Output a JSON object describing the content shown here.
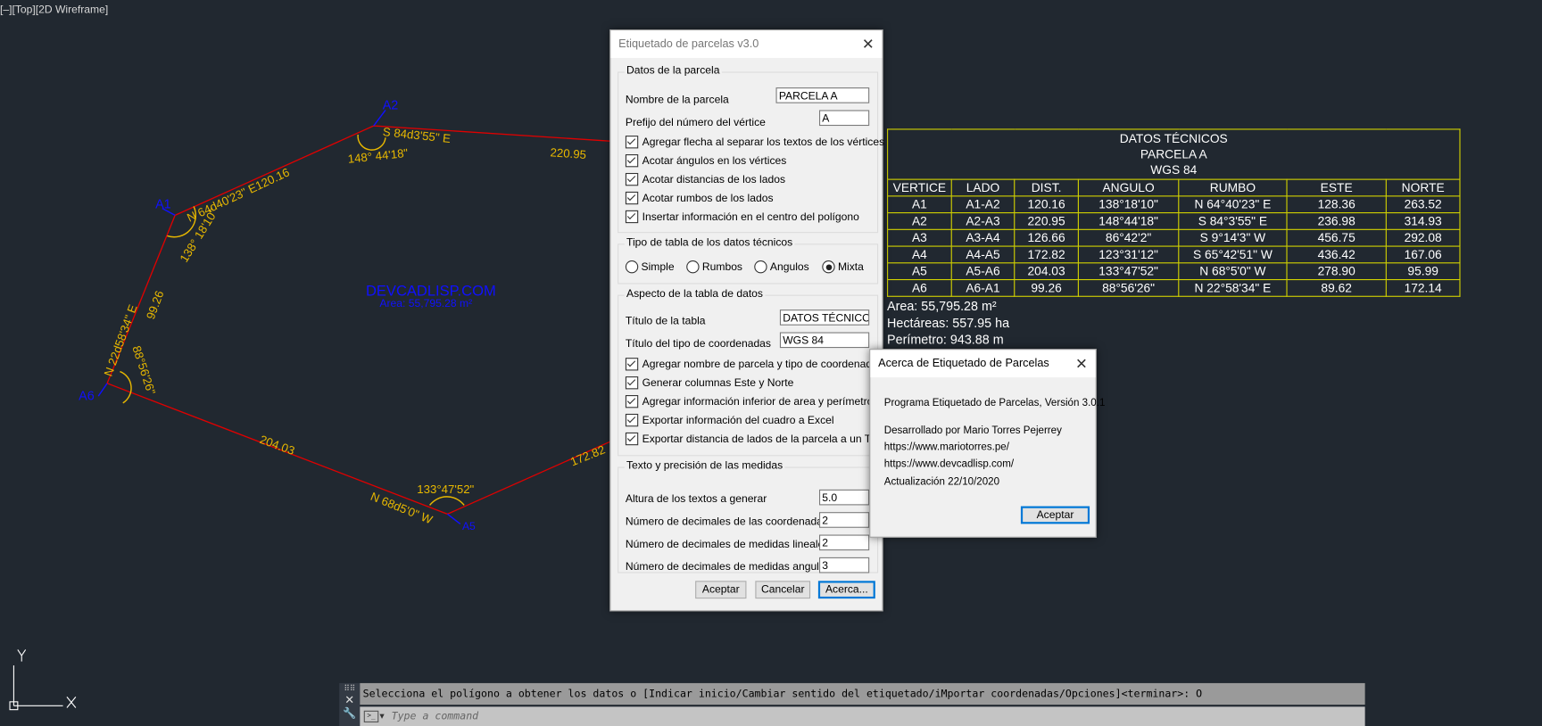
{
  "viewport": {
    "label": "[–][Top][2D Wireframe]"
  },
  "colors": {
    "background": "#212830",
    "polyline": "#e00000",
    "dim_text": "#e8b800",
    "vertex": "#1010ff",
    "table_border": "#d4d400",
    "accent": "#0078d7"
  },
  "drawing": {
    "vertices": [
      "A1",
      "A2",
      "A5",
      "A6"
    ],
    "labels": [
      "220.95",
      "148° 44'18\"",
      "S 84d3'55\" E",
      "N 64d40'23\" E120.16",
      "138° 18'10\"",
      "99.26",
      "N 22d58'34\" E",
      "88°56'26\"",
      "204.03",
      "N 68d5'0\" W",
      "133°47'52\"",
      "172.82"
    ],
    "center_title": "DEVCADLISP.COM",
    "center_area": "Area: 55,795.28 m²"
  },
  "dialog": {
    "title": "Etiquetado de parcelas v3.0",
    "group1": {
      "title": "Datos de la parcela",
      "name_label": "Nombre de la parcela",
      "name_value": "PARCELA A",
      "prefix_label": "Prefijo del número del vértice",
      "prefix_value": "A",
      "checks": [
        "Agregar flecha al separar los textos de los vértices",
        "Acotar ángulos en los vértices",
        "Acotar distancias de los lados",
        "Acotar rumbos de los lados",
        "Insertar información en el centro del polígono"
      ]
    },
    "group2": {
      "title": "Tipo de tabla de los datos técnicos",
      "options": [
        "Simple",
        "Rumbos",
        "Angulos",
        "Mixta"
      ],
      "selected": "Mixta"
    },
    "group3": {
      "title": "Aspecto de la tabla de datos",
      "table_title_label": "Título de la tabla",
      "table_title_value": "DATOS TÉCNICOS",
      "coord_label": "Título del tipo de coordenadas",
      "coord_value": "WGS 84",
      "checks": [
        "Agregar nombre de parcela y tipo de coordenadas",
        "Generar columnas Este y Norte",
        "Agregar información inferior de area y perímetro",
        "Exportar información del cuadro a Excel",
        "Exportar distancia de lados de la parcela a un TXT"
      ]
    },
    "group4": {
      "title": "Texto y precisión de las medidas",
      "rows": [
        {
          "label": "Altura de los textos a generar",
          "value": "5.0"
        },
        {
          "label": "Número de decimales de las coordenadas",
          "value": "2"
        },
        {
          "label": "Número de decimales de medidas lineales",
          "value": "2"
        },
        {
          "label": "Número de decimales de medidas angulares",
          "value": "3"
        }
      ]
    },
    "buttons": {
      "ok": "Aceptar",
      "cancel": "Cancelar",
      "about": "Acerca..."
    }
  },
  "table": {
    "titles": [
      "DATOS TÉCNICOS",
      "PARCELA A",
      "WGS 84"
    ],
    "headers": [
      "VERTICE",
      "LADO",
      "DIST.",
      "ANGULO",
      "RUMBO",
      "ESTE",
      "NORTE"
    ],
    "rows": [
      [
        "A1",
        "A1-A2",
        "120.16",
        "138°18'10\"",
        "N 64°40'23\" E",
        "128.36",
        "263.52"
      ],
      [
        "A2",
        "A2-A3",
        "220.95",
        "148°44'18\"",
        "S 84°3'55\" E",
        "236.98",
        "314.93"
      ],
      [
        "A3",
        "A3-A4",
        "126.66",
        "86°42'2\"",
        "S 9°14'3\" W",
        "456.75",
        "292.08"
      ],
      [
        "A4",
        "A4-A5",
        "172.82",
        "123°31'12\"",
        "S 65°42'51\" W",
        "436.42",
        "167.06"
      ],
      [
        "A5",
        "A5-A6",
        "204.03",
        "133°47'52\"",
        "N 68°5'0\" W",
        "278.90",
        "95.99"
      ],
      [
        "A6",
        "A6-A1",
        "99.26",
        "88°56'26\"",
        "N 22°58'34\" E",
        "89.62",
        "172.14"
      ]
    ],
    "area": "Area: 55,795.28 m²",
    "hectares": "Hectáreas: 557.95 ha",
    "perimeter": "Perímetro: 943.88 m"
  },
  "about": {
    "title": "Acerca de Etiquetado de Parcelas",
    "program": "Programa Etiquetado de Parcelas, Versión 3.0.1",
    "author": "Desarrollado por Mario Torres Pejerrey",
    "url1": "https://www.mariotorres.pe/",
    "url2": "https://www.devcadlisp.com/",
    "updated": "Actualización 22/10/2020",
    "ok": "Aceptar"
  },
  "ucs": {
    "x": "X",
    "y": "Y"
  },
  "command": {
    "history": "Selecciona el polígono a obtener los datos o [Indicar inicio/Cambiar sentido del etiquetado/iMportar coordenadas/Opciones]<terminar>: O",
    "placeholder": "Type a command"
  }
}
